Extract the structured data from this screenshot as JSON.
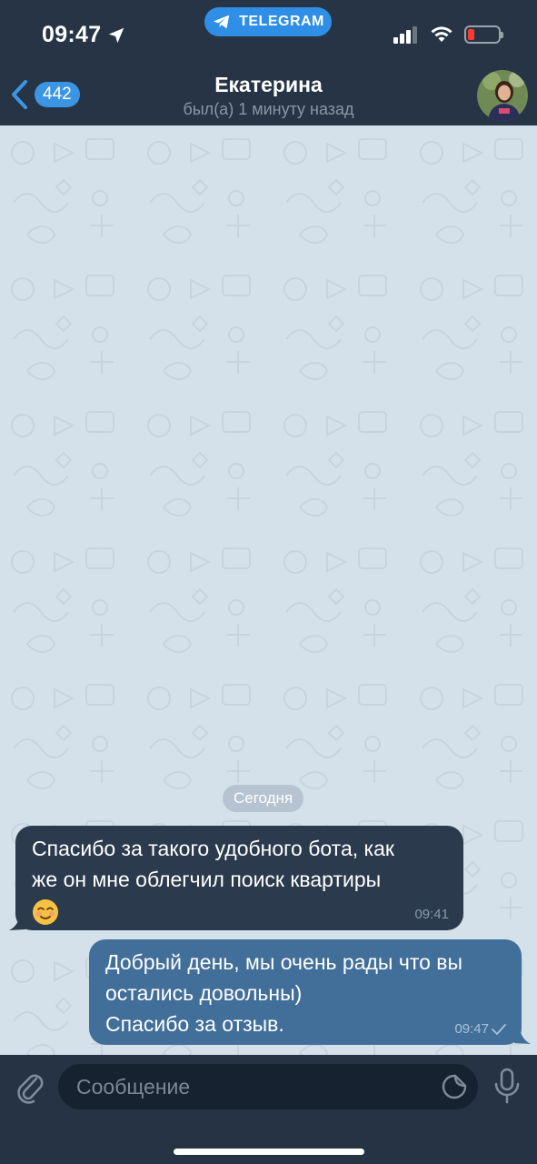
{
  "status_bar": {
    "time": "09:47",
    "app_pill": "TELEGRAM"
  },
  "header": {
    "back_count": "442",
    "title": "Екатерина",
    "subtitle": "был(а) 1 минуту назад"
  },
  "chat": {
    "date_label": "Сегодня",
    "messages": [
      {
        "direction": "incoming",
        "lines": [
          "Спасибо за такого удобного бота, как",
          "же он мне облегчил поиск квартиры"
        ],
        "emoji": "☺️",
        "time": "09:41"
      },
      {
        "direction": "outgoing",
        "lines": [
          "Добрый день, мы очень рады что вы",
          "остались довольны)",
          "Спасибо за отзыв."
        ],
        "time": "09:47",
        "status": "read-check-icon"
      }
    ]
  },
  "input": {
    "placeholder": "Сообщение"
  },
  "icons": {
    "back": "chevron-left-icon",
    "attach": "paperclip-icon",
    "sticker": "sticker-icon",
    "mic": "microphone-icon",
    "location": "location-arrow-icon",
    "telegram": "telegram-plane-icon"
  },
  "colors": {
    "header_bg": "#263445",
    "incoming_bubble": "#2b3b4d",
    "outgoing_bubble": "#426f99",
    "badge": "#3c95e2",
    "pill": "#2f8fe6",
    "chat_bg": "#d5e1ea"
  }
}
